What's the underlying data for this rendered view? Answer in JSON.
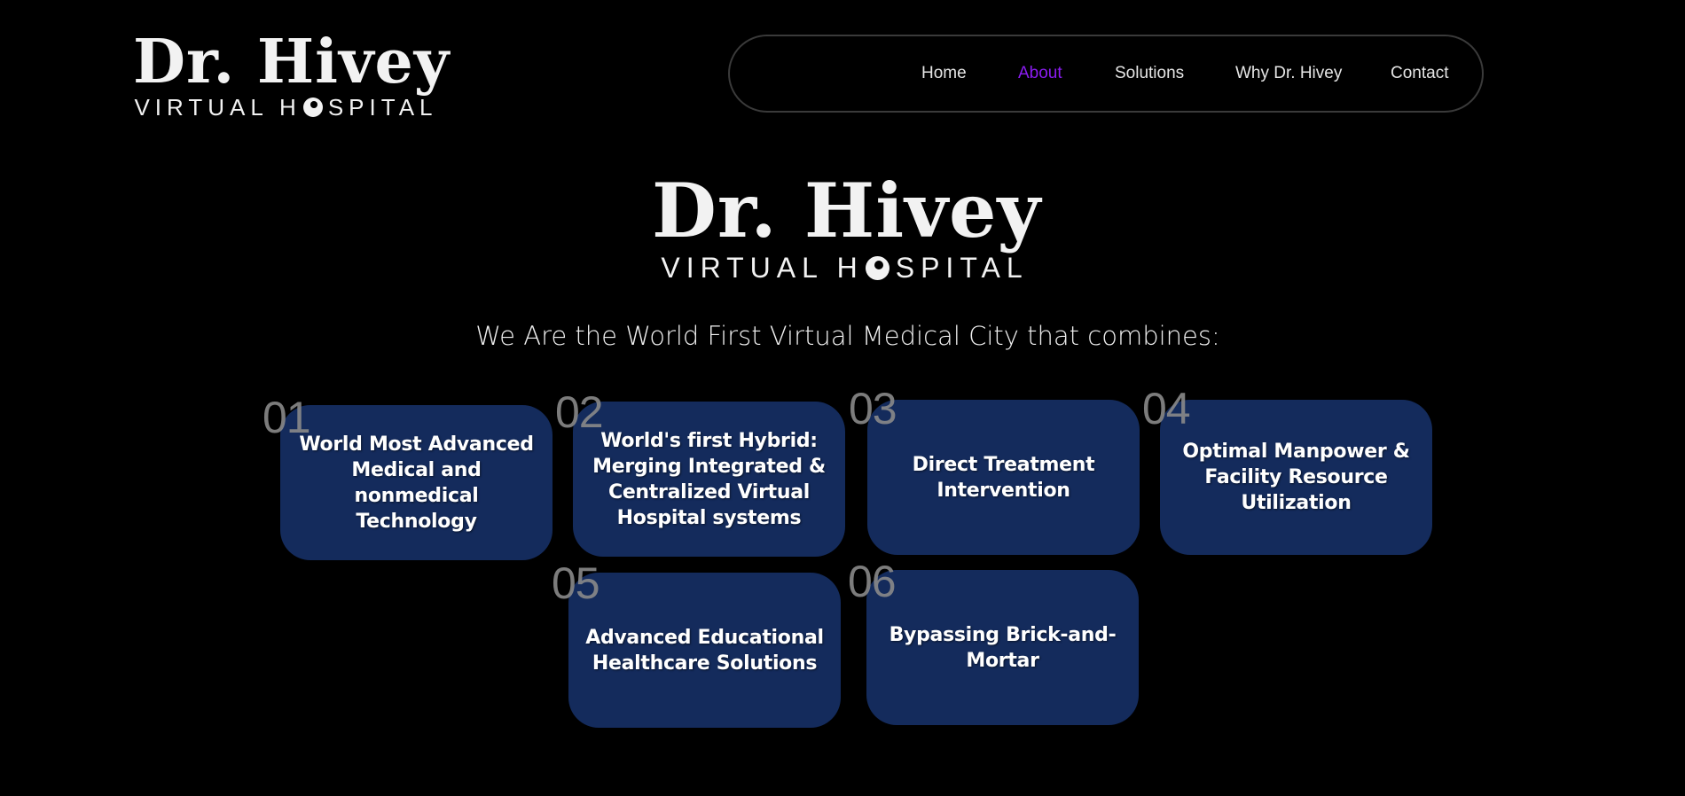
{
  "header": {
    "logo": {
      "title": "Dr. Hivey",
      "subtitle_before": "VIRTUAL H",
      "subtitle_after": "SPITAL"
    },
    "nav": [
      {
        "label": "Home",
        "active": false
      },
      {
        "label": "About",
        "active": true
      },
      {
        "label": "Solutions",
        "active": false
      },
      {
        "label": "Why Dr. Hivey",
        "active": false
      },
      {
        "label": "Contact",
        "active": false
      }
    ]
  },
  "hero": {
    "logo": {
      "title": "Dr. Hivey",
      "subtitle_before": "VIRTUAL H",
      "subtitle_after": "SPITAL"
    },
    "headline": "We Are the World First Virtual Medical City that combines:"
  },
  "features": [
    {
      "number": "01",
      "text": "World Most Advanced Medical and nonmedical Technology"
    },
    {
      "number": "02",
      "text": "World's first Hybrid: Merging Integrated & Centralized Virtual Hospital systems"
    },
    {
      "number": "03",
      "text": "Direct Treatment Intervention"
    },
    {
      "number": "04",
      "text": "Optimal Manpower & Facility Resource Utilization"
    },
    {
      "number": "05",
      "text": "Advanced Educational Healthcare Solutions"
    },
    {
      "number": "06",
      "text": "Bypassing Brick-and-Mortar"
    }
  ],
  "colors": {
    "background": "#000000",
    "card": "#142b5c",
    "nav_active": "#8a1cf0",
    "nav_text": "#e6e6e6",
    "number": "#8a8a8a"
  }
}
